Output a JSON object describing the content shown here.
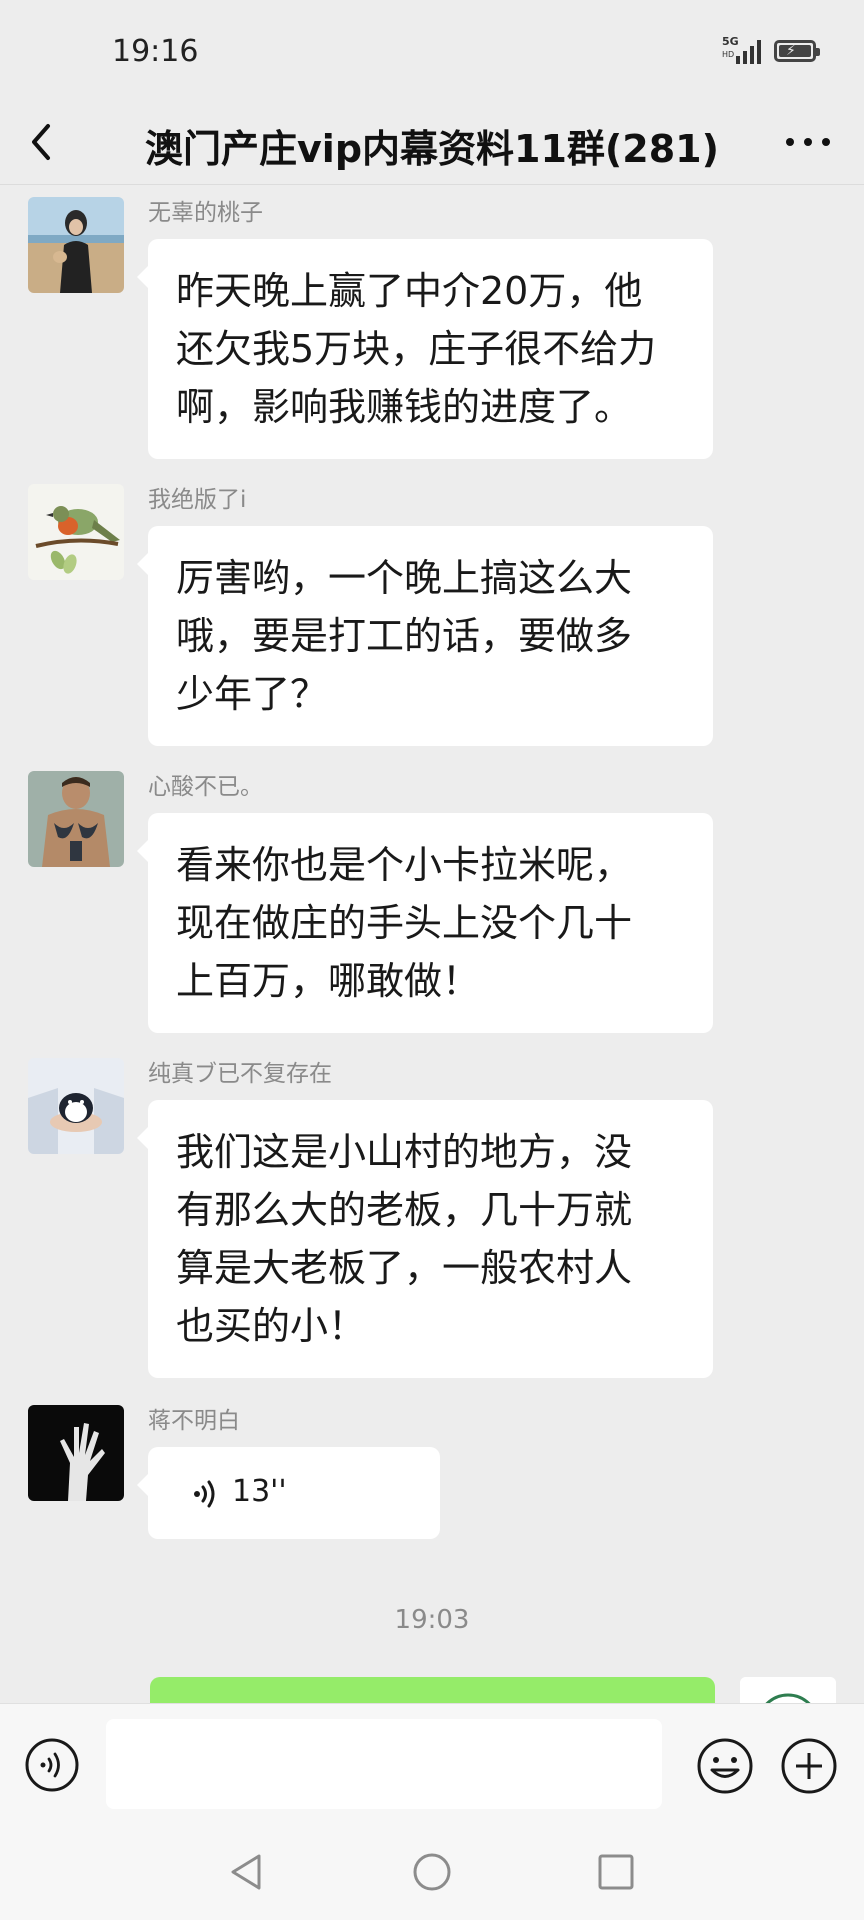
{
  "status_bar": {
    "time": "19:16",
    "network": "5G",
    "network_sub": "HD"
  },
  "header": {
    "title": "澳门产庄vip内幕资料11群(281)"
  },
  "messages": [
    {
      "sender": "无辜的桃子",
      "avatar_icon": "beach-person-avatar",
      "lines": [
        "昨天晚上赢了中介20万，他",
        "还欠我5万块，庄子很不给力",
        "啊，影响我赚钱的进度了。"
      ]
    },
    {
      "sender": "我绝版了i",
      "avatar_icon": "bird-avatar",
      "lines": [
        "厉害哟，一个晚上搞这么大",
        "哦，要是打工的话，要做多",
        "少年了？"
      ]
    },
    {
      "sender": "心酸不已。",
      "avatar_icon": "tattooed-man-avatar",
      "lines": [
        "看来你也是个小卡拉米呢，",
        "现在做庄的手头上没个几十",
        "上百万，哪敢做！"
      ]
    },
    {
      "sender": "纯真ブ已不复存在",
      "avatar_icon": "hands-holding-toy-avatar",
      "lines": [
        "我们这是小山村的地方，没",
        "有那么大的老板，几十万就",
        "算是大老板了，一般农村人",
        "也买的小！"
      ]
    },
    {
      "sender": "蒋不明白",
      "avatar_icon": "hand-silhouette-avatar",
      "voice_duration": "13''"
    }
  ],
  "time_divider": "19:03",
  "colors": {
    "background": "#ededed",
    "bubble": "#ffffff",
    "self_bubble": "#95ec69",
    "meta_text": "#8a8a8a"
  }
}
